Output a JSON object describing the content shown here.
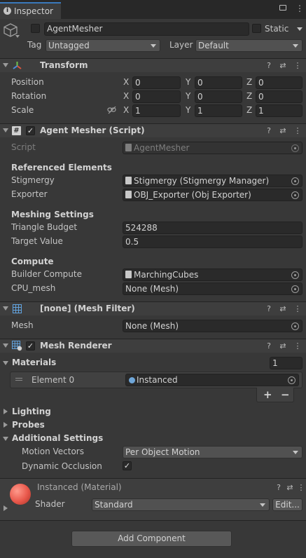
{
  "tab": {
    "label": "Inspector"
  },
  "object": {
    "name": "AgentMesher",
    "static_label": "Static",
    "tag_label": "Tag",
    "tag_value": "Untagged",
    "layer_label": "Layer",
    "layer_value": "Default"
  },
  "transform": {
    "title": "Transform",
    "position": {
      "label": "Position",
      "x": "0",
      "y": "0",
      "z": "0"
    },
    "rotation": {
      "label": "Rotation",
      "x": "0",
      "y": "0",
      "z": "0"
    },
    "scale": {
      "label": "Scale",
      "x": "1",
      "y": "1",
      "z": "1"
    },
    "axis_x": "X",
    "axis_y": "Y",
    "axis_z": "Z"
  },
  "agent_mesher": {
    "title": "Agent Mesher (Script)",
    "script_label": "Script",
    "script_value": "AgentMesher",
    "referenced_header": "Referenced Elements",
    "stigmergy_label": "Stigmergy",
    "stigmergy_value": "Stigmergy (Stigmergy Manager)",
    "exporter_label": "Exporter",
    "exporter_value": "OBJ_Exporter (Obj Exporter)",
    "meshing_header": "Meshing Settings",
    "triangle_label": "Triangle Budget",
    "triangle_value": "524288",
    "target_label": "Target Value",
    "target_value": "0.5",
    "compute_header": "Compute",
    "builder_label": "Builder Compute",
    "builder_value": "MarchingCubes",
    "cpu_label": "CPU_mesh",
    "cpu_value": "None (Mesh)"
  },
  "mesh_filter": {
    "title": "[none] (Mesh Filter)",
    "mesh_label": "Mesh",
    "mesh_value": "None (Mesh)"
  },
  "mesh_renderer": {
    "title": "Mesh Renderer",
    "materials_label": "Materials",
    "materials_count": "1",
    "element_label": "Element 0",
    "element_value": "Instanced",
    "add_symbol": "+",
    "remove_symbol": "−",
    "lighting_label": "Lighting",
    "probes_label": "Probes",
    "additional_label": "Additional Settings",
    "motion_label": "Motion Vectors",
    "motion_value": "Per Object Motion",
    "occlusion_label": "Dynamic Occlusion"
  },
  "material": {
    "title": "Instanced (Material)",
    "shader_label": "Shader",
    "shader_value": "Standard",
    "edit_label": "Edit..."
  },
  "add_component": {
    "label": "Add Component"
  },
  "colors": {
    "accent": "#3a79bb",
    "background": "#383838",
    "material_sphere": "#e8574a"
  }
}
